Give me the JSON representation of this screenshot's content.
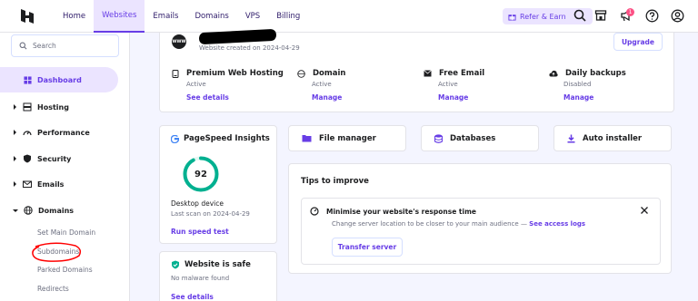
{
  "topbar": {
    "nav": [
      "Home",
      "Websites",
      "Emails",
      "Domains",
      "VPS",
      "Billing"
    ],
    "active_nav": "Websites",
    "refer_label": "Refer & Earn",
    "notification_count": "1"
  },
  "sidebar": {
    "search_placeholder": "Search",
    "dashboard_label": "Dashboard",
    "items": [
      "Hosting",
      "Performance",
      "Security",
      "Emails",
      "Domains"
    ],
    "domain_subitems": [
      "Set Main Domain",
      "Subdomains",
      "Parked Domains",
      "Redirects"
    ]
  },
  "website": {
    "created_text": "Website created on 2024-04-29",
    "upgrade_label": "Upgrade",
    "services": [
      {
        "title": "Premium Web Hosting",
        "status": "Active",
        "link": "See details",
        "icon": "server-icon"
      },
      {
        "title": "Domain",
        "status": "Active",
        "link": "Manage",
        "icon": "globe-icon"
      },
      {
        "title": "Free Email",
        "status": "Active",
        "link": "Manage",
        "icon": "mail-icon"
      },
      {
        "title": "Daily backups",
        "status": "Disabled",
        "link": "Manage",
        "icon": "cloud-upload-icon"
      }
    ]
  },
  "pagespeed": {
    "title": "PageSpeed Insights",
    "score": "92",
    "score_value": 92,
    "device": "Desktop device",
    "last_scan": "Last scan on 2024-04-29",
    "link": "Run speed test"
  },
  "safe": {
    "title": "Website is safe",
    "subtitle": "No malware found",
    "link": "See details"
  },
  "tools": [
    "File manager",
    "Databases",
    "Auto installer"
  ],
  "tips": {
    "title": "Tips to improve",
    "tip_title": "Minimise your website's response time",
    "tip_desc": "Change server location to be closer to your main audience — ",
    "tip_link": "See access logs",
    "button": "Transfer server"
  },
  "colors": {
    "accent": "#673de6",
    "accent_light": "#ebe4ff",
    "success": "#00b090",
    "annotation": "#ff0000"
  }
}
